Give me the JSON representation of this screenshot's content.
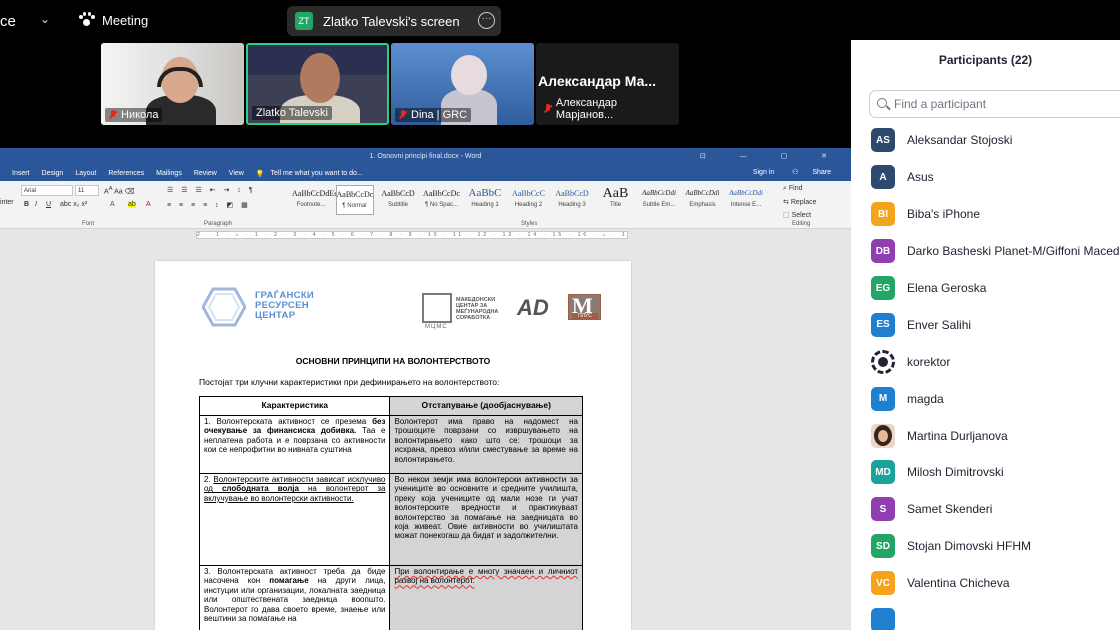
{
  "topbar": {
    "app_name_fragment": "ce",
    "meeting_label": "Meeting",
    "share_initials": "ZT",
    "share_label": "Zlatko Talevski's screen",
    "more_label": "···"
  },
  "videos": [
    {
      "name": "Никола",
      "muted": true
    },
    {
      "name": "Zlatko Talevski",
      "muted": false,
      "active": true
    },
    {
      "name": "Dina | GRC",
      "muted": true
    },
    {
      "name": "Александар Марјанов...",
      "muted": true,
      "big_name": "Александар Ма..."
    }
  ],
  "word": {
    "title": "1. Osnovni principi final.docx - Word",
    "window_controls": "⊡ — ▢ ✕",
    "tabs": [
      "Insert",
      "Design",
      "Layout",
      "References",
      "Mailings",
      "Review",
      "View"
    ],
    "tell_me": "Tell me what you want to do...",
    "sign_in": "Sign in",
    "share": "Share",
    "font_name": "Arial",
    "font_size": "11",
    "group_font": "Font",
    "group_paragraph": "Paragraph",
    "group_styles": "Styles",
    "group_editing": "Editing",
    "left_fragment": "inter",
    "styles": [
      {
        "sample": "AaBbCcDdEe",
        "name": "Footnote..."
      },
      {
        "sample": "AaBbCcDc",
        "name": "¶ Normal"
      },
      {
        "sample": "AaBbCcD",
        "name": "Subtitle"
      },
      {
        "sample": "AaBbCcDc",
        "name": "¶ No Spac..."
      },
      {
        "sample": "AaBbC",
        "name": "Heading 1"
      },
      {
        "sample": "AaBbCcC",
        "name": "Heading 2"
      },
      {
        "sample": "AaBbCcD",
        "name": "Heading 3"
      },
      {
        "sample": "AaB",
        "name": "Title"
      },
      {
        "sample": "AaBbCcDdi",
        "name": "Subtle Em..."
      },
      {
        "sample": "AaBbCcDdi",
        "name": "Emphasis"
      },
      {
        "sample": "AaBbCcDdi",
        "name": "Intense E..."
      }
    ],
    "editing": {
      "find": "Find",
      "replace": "Replace",
      "select": "Select"
    },
    "ruler": "2 · 1 · ⌂ · 1 · 2 · 3 · 4 · 5 · 6 · 7 · 8 · 9 · 10 · 11 · 12 · 13 · 14 · 15 · 16 · ⌂ · 18"
  },
  "document": {
    "grc_logo": [
      "ГРАЃАНСКИ",
      "РЕСУРСЕН",
      "ЦЕНТАР"
    ],
    "mcms_acronym": "МЦМС",
    "mcms_text": [
      "МАКЕДОНСКИ",
      "ЦЕНТАР ЗА",
      "МЕЃУНАРОДНА",
      "СОРАБОТКА"
    ],
    "ad_logo": "AD",
    "m_logo": "M",
    "m_logo_sub": "ПЛУС",
    "title": "ОСНОВНИ ПРИНЦИПИ НА ВОЛОНТЕРСТВОТО",
    "intro": "Постојат три клучни карактеристики при дефинирањето на волонтерството:",
    "table": {
      "col1_header": "Карактеристика",
      "col2_header": "Отстапување (дообјаснување)",
      "row1": {
        "c1_a": "1.   Волонтерската активност се презема ",
        "c1_b": "без очекување за финансиска добивка.",
        "c1_c": " Таа е неплатена работа и е поврзана со активности кои се непрофитни во нивната суштина",
        "c2": "Волонтерот има право на надомест на трошоците поврзани со извршувањето на волонтирањето како што се: трошоци за исхрана, превоз и/или сместување за време на волонтирањето."
      },
      "row2": {
        "c1_a": "2.   ",
        "c1_b": "Волонтерските активности зависат исклучиво од ",
        "c1_c": "слободната волја",
        "c1_d": " на волонтерот за вклучување во волонтерски активности.",
        "c2": "Во некои земји има волонтерски активности за учениците во основните и средните училишта, преку која учениците од мали нозе ги учат волонтерските вредности и практикуваат волонтерство за помагање на заедницата во која живеат. Овие активности во училиштата можат понекогаш да бидат и задолжителни."
      },
      "row3": {
        "c1_a": "3.   Волонтерската активност треба да биде насочена кон ",
        "c1_b": "помагање",
        "c1_c": " на други лица, инстуции или организации, локалната заедница или општествената заедница воопшто. Волонтерот го дава своето време, знаење или вештини за помагање на",
        "c2": "При волонтирање е многу значаен и личниот развој на волонтерот."
      }
    }
  },
  "participants": {
    "title": "Participants (22)",
    "search_placeholder": "Find a participant",
    "list": [
      {
        "initials": "AS",
        "name": "Aleksandar Stojoski",
        "color": "#2d4a6e",
        "kind": "initials"
      },
      {
        "initials": "A",
        "name": "Asus",
        "color": "#2d4a6e",
        "kind": "initials"
      },
      {
        "initials": "BI",
        "name": "Biba's iPhone",
        "color": "#f5a31b",
        "kind": "initials"
      },
      {
        "initials": "DB",
        "name": "Darko Basheski Planet-M/Giffoni Macedonia",
        "color": "#8f3fb0",
        "kind": "initials"
      },
      {
        "initials": "EG",
        "name": "Elena Geroska",
        "color": "#23a566",
        "kind": "initials"
      },
      {
        "initials": "ES",
        "name": "Enver Salihi",
        "color": "#1f7fd1",
        "kind": "initials"
      },
      {
        "initials": "",
        "name": "korektor",
        "color": "#232333",
        "kind": "gear"
      },
      {
        "initials": "M",
        "name": "magda",
        "color": "#1f7fd1",
        "kind": "initials"
      },
      {
        "initials": "",
        "name": "Martina Durljanova",
        "color": "#3a2418",
        "kind": "photo"
      },
      {
        "initials": "MD",
        "name": "Milosh Dimitrovski",
        "color": "#1aa39a",
        "kind": "initials"
      },
      {
        "initials": "S",
        "name": "Samet Skenderi",
        "color": "#8f3fb0",
        "kind": "initials"
      },
      {
        "initials": "SD",
        "name": "Stojan Dimovski HFHM",
        "color": "#23a566",
        "kind": "initials"
      },
      {
        "initials": "VC",
        "name": "Valentina Chicheva",
        "color": "#f5a31b",
        "kind": "initials"
      },
      {
        "initials": "",
        "name": "",
        "color": "#1f7fd1",
        "kind": "initials"
      }
    ]
  }
}
